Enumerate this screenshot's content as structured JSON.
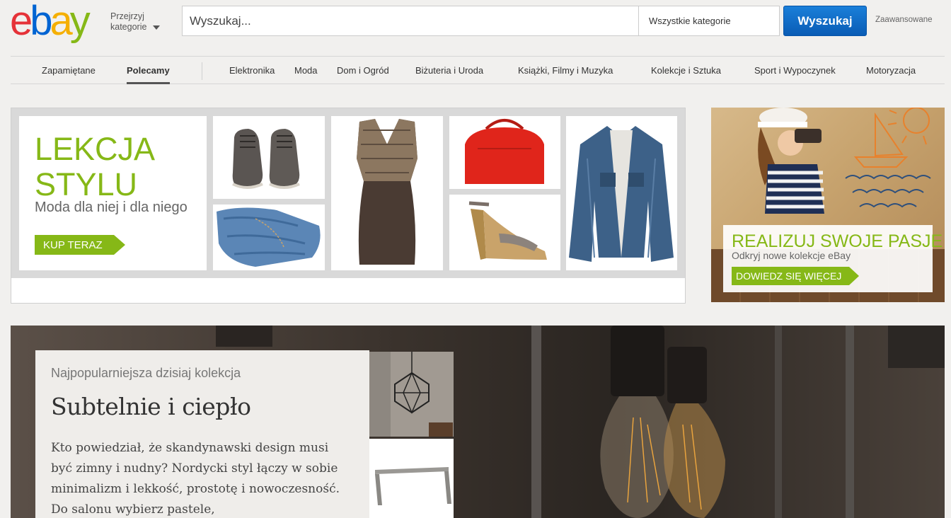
{
  "header": {
    "logo": {
      "e": "e",
      "b": "b",
      "a": "a",
      "y": "y"
    },
    "browse_line1": "Przejrzyj",
    "browse_line2": "kategorie",
    "search_placeholder": "Wyszukaj...",
    "category_select": "Wszystkie kategorie",
    "search_button": "Wyszukaj",
    "advanced": "Zaawansowane"
  },
  "nav": {
    "items": [
      {
        "label": "Zapamiętane"
      },
      {
        "label": "Polecamy"
      },
      {
        "label": "Elektronika"
      },
      {
        "label": "Moda"
      },
      {
        "label": "Dom i Ogród"
      },
      {
        "label": "Biżuteria i Uroda"
      },
      {
        "label": "Książki, Filmy i Muzyka"
      },
      {
        "label": "Kolekcje i Sztuka"
      },
      {
        "label": "Sport i Wypoczynek"
      },
      {
        "label": "Motoryzacja"
      }
    ],
    "active": "Polecamy"
  },
  "carousel": {
    "title_line1": "LEKCJA",
    "title_line2": "STYLU",
    "subtitle": "Moda dla niej i dla niego",
    "button": "KUP TERAZ",
    "slide_count": 4,
    "active_slide": 1,
    "prev_icon": "‹",
    "next_icon": "›"
  },
  "side_ad": {
    "title": "REALIZUJ SWOJE PASJE",
    "subtitle": "Odkryj nowe kolekcje eBay",
    "button": "DOWIEDZ SIĘ WIĘCEJ"
  },
  "collection": {
    "kicker": "Najpopularniejsza dzisiaj kolekcja",
    "title": "Subtelnie i ciepło",
    "text": "Kto powiedział, że skandynawski design musi być zimny i nudny? Nordycki styl łączy w sobie minimalizm i lekkość, prostotę i nowoczesność. Do salonu wybierz pastele,"
  },
  "colors": {
    "ebay_red": "#e53238",
    "ebay_blue": "#0064d2",
    "ebay_yellow": "#f5af02",
    "ebay_green": "#86b817",
    "search_blue": "#0a5cb5"
  }
}
